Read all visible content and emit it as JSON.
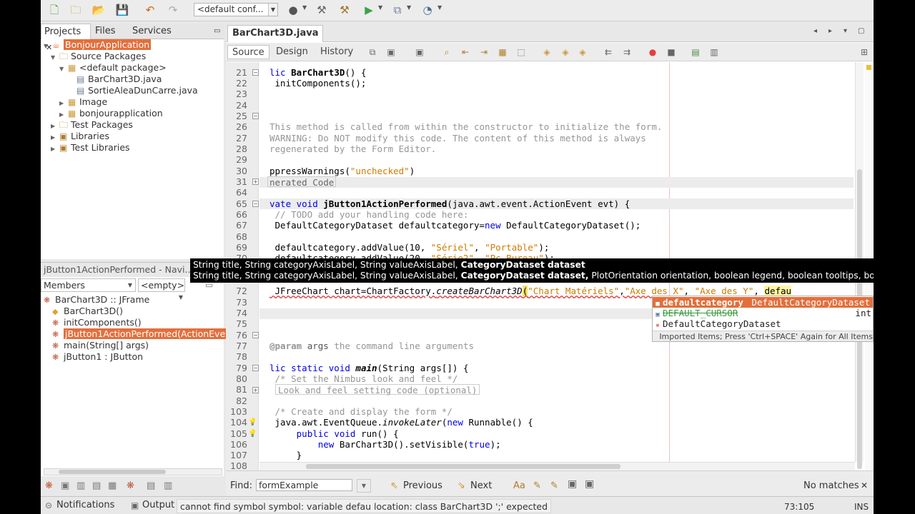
{
  "window": {
    "title": "BonjourApplication"
  },
  "toolbar": {
    "config_value": "<default conf..."
  },
  "projects": {
    "tabs": [
      "Projects",
      "Files",
      "Services"
    ],
    "tree": [
      {
        "label": "BonjourApplication",
        "selected": true
      },
      {
        "label": "Source Packages"
      },
      {
        "label": "<default package>"
      },
      {
        "label": "BarChart3D.java"
      },
      {
        "label": "SortieAleaDunCarre.java"
      },
      {
        "label": "Image"
      },
      {
        "label": "bonjourapplication"
      },
      {
        "label": "Test Packages"
      },
      {
        "label": "Libraries"
      },
      {
        "label": "Test Libraries"
      }
    ]
  },
  "navigator": {
    "title": "jButton1ActionPerformed - Navi...",
    "members_label": "Members",
    "filter_value": "<empty>",
    "items": [
      {
        "label": "BarChart3D :: JFrame"
      },
      {
        "label": "BarChart3D()"
      },
      {
        "label": "initComponents()"
      },
      {
        "label": "jButton1ActionPerformed(ActionEven",
        "selected": true
      },
      {
        "label": "main(String[] args)"
      },
      {
        "label": "jButton1 : JButton"
      }
    ]
  },
  "editor": {
    "file_tab": "BarChart3D.java",
    "tabs": [
      "Source",
      "Design",
      "History"
    ],
    "line_numbers": [
      "21",
      "22",
      "23",
      "24",
      "25",
      "26",
      "27",
      "28",
      "29",
      "30",
      "31",
      "64",
      "65",
      "66",
      "67",
      "68",
      "69",
      "70",
      "",
      "72",
      "73",
      "74",
      "75",
      "76",
      "77",
      "78",
      "79",
      "80",
      "81",
      "82",
      "103",
      "104",
      "105",
      "106",
      "107",
      "108",
      "109"
    ],
    "code": {
      "l21_a": "lic ",
      "l21_b": "BarChart3D",
      "l21_c": "() {",
      "l22": " initComponents();",
      "l26": "This method is called from within the constructor to initialize the form.",
      "l27": "WARNING: Do NOT modify this code. The content of this method is always",
      "l28": "regenerated by the Form Editor.",
      "l30_a": "ppressWarnings(",
      "l30_b": "\"unchecked\"",
      "l30_c": ")",
      "l31": "nerated Code",
      "l65_a": "vate void ",
      "l65_b": "jButton1ActionPerformed",
      "l65_c": "(java.awt.event.ActionEvent evt) {",
      "l66": " // TODO add your handling code here:",
      "l67_a": " DefaultCategoryDataset defaultcategory=",
      "l67_b": "new",
      "l67_c": " DefaultCategoryDataset();",
      "l69_a": " defaultcategory.addValue(10, ",
      "l69_b": "\"Sériel\"",
      "l69_c": ", ",
      "l69_d": "\"Portable\"",
      "l69_e": ");",
      "l70_a": " defaultcategory.addValue(20, ",
      "l70_b": "\"Série2\"",
      "l70_c": ", ",
      "l70_d": "\"Pc Bureau\"",
      "l70_e": ");",
      "l73_a": " JFreeChart chart=ChartFactory.",
      "l73_b": "createBarChart3D",
      "l73_c": "(",
      "l73_d": "\"Chart Matériels\"",
      "l73_e": ",",
      "l73_f": "\"Axe des X\"",
      "l73_g": ", ",
      "l73_h": "\"Axe des Y\"",
      "l73_i": ", ",
      "l73_j": "defau",
      "l78_a": "@param ",
      "l78_b": "args",
      "l78_c": " the command line arguments",
      "l80_a": "lic static void ",
      "l80_b": "main",
      "l80_c": "(String args[]) {",
      "l81": " /* Set the Nimbus look and feel */",
      "l82": "Look and feel setting code (optional)",
      "l104": " /* Create and display the form */",
      "l105_a": " java.awt.EventQueue.",
      "l105_b": "invokeLater",
      "l105_c": "(",
      "l105_d": "new",
      "l105_e": " Runnable() {",
      "l106_a": "     ",
      "l106_b": "public void ",
      "l106_c": "run",
      "l106_d": "() {",
      "l107_a": "         ",
      "l107_b": "new",
      "l107_c": " BarChart3D().setVisible(",
      "l107_d": "true",
      "l107_e": ");",
      "l108": "     }",
      "l109": " });"
    }
  },
  "tooltip": {
    "line1_a": "String title, String categoryAxisLabel, String valueAxisLabel, ",
    "line1_b": "CategoryDataset dataset",
    "line2_a": "String title, String categoryAxisLabel, String valueAxisLabel, ",
    "line2_b": "CategoryDataset dataset,",
    "line2_c": " PlotOrientation orientation, boolean legend, boolean tooltips, boolean urls"
  },
  "completion": {
    "items": [
      {
        "name": "defaultcategory",
        "type": "DefaultCategoryDataset"
      },
      {
        "name": "DEFAULT_CURSOR",
        "type": "int"
      },
      {
        "name": "DefaultCategoryDataset",
        "type": ""
      }
    ],
    "hint": "Imported Items; Press 'Ctrl+SPACE' Again for All Items"
  },
  "find": {
    "label": "Find:",
    "value": "formExample",
    "previous": "Previous",
    "next": "Next",
    "result": "No matches"
  },
  "status": {
    "notifications": "Notifications",
    "output": "Output",
    "message": "cannot find symbol  symbol:  variable defau  location: class BarChart3D  ';' expected",
    "position": "73:105",
    "mode": "INS"
  },
  "colors": {
    "selection": "#e36f3c",
    "keyword": "#0000e6",
    "string": "#ce7b00",
    "comment": "#969696"
  }
}
